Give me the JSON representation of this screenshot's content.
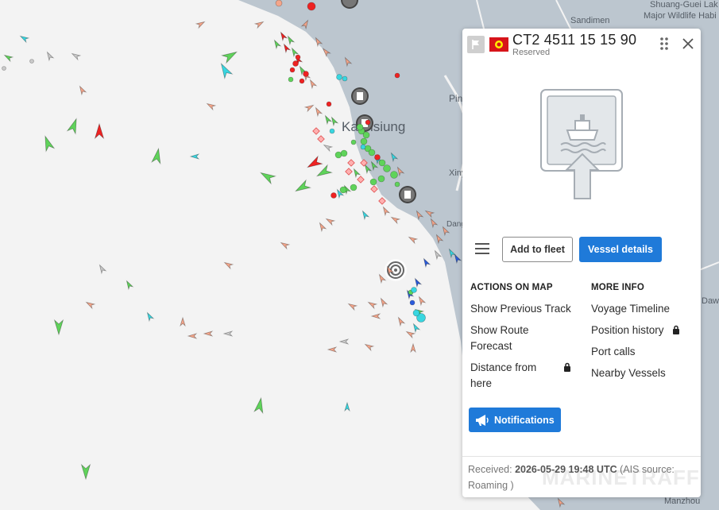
{
  "map": {
    "labels": {
      "kaohsiung": "Kaohsiung",
      "sandimen": "Sandimen",
      "shuanggui_1": "Shuang-Guei Lak",
      "shuanggui_2": "Major Wildlife Habi",
      "pin": "Pin",
      "xiny": "Xiny",
      "dang": "Dang",
      "daw": "Daw",
      "manzhou": "Manzhou"
    }
  },
  "panel": {
    "vessel_name": "CT2 4511 15 15 90",
    "status": "Reserved",
    "flag_color": "#d7141a",
    "accent_color": "#1f7ad9",
    "buttons": {
      "add_to_fleet": "Add to fleet",
      "vessel_details": "Vessel details",
      "notifications": "Notifications"
    },
    "actions_on_map": {
      "title": "ACTIONS ON MAP",
      "items": [
        "Show Previous Track",
        "Show Route Forecast",
        "Distance from here"
      ]
    },
    "more_info": {
      "title": "MORE INFO",
      "items": [
        "Voyage Timeline",
        "Position history",
        "Port calls",
        "Nearby Vessels"
      ]
    },
    "footer": {
      "received_label": "Received:",
      "received_time": "2026-05-29 19:48 UTC",
      "source": "(AIS source: Roaming )"
    },
    "watermark": "MARINETRAFFIC",
    "icons": [
      "flag-icon",
      "kyrgyzstan-flag-icon",
      "drag-handle-icon",
      "close-icon",
      "vessel-placeholder-icon",
      "menu-icon",
      "lock-icon",
      "megaphone-icon"
    ]
  }
}
